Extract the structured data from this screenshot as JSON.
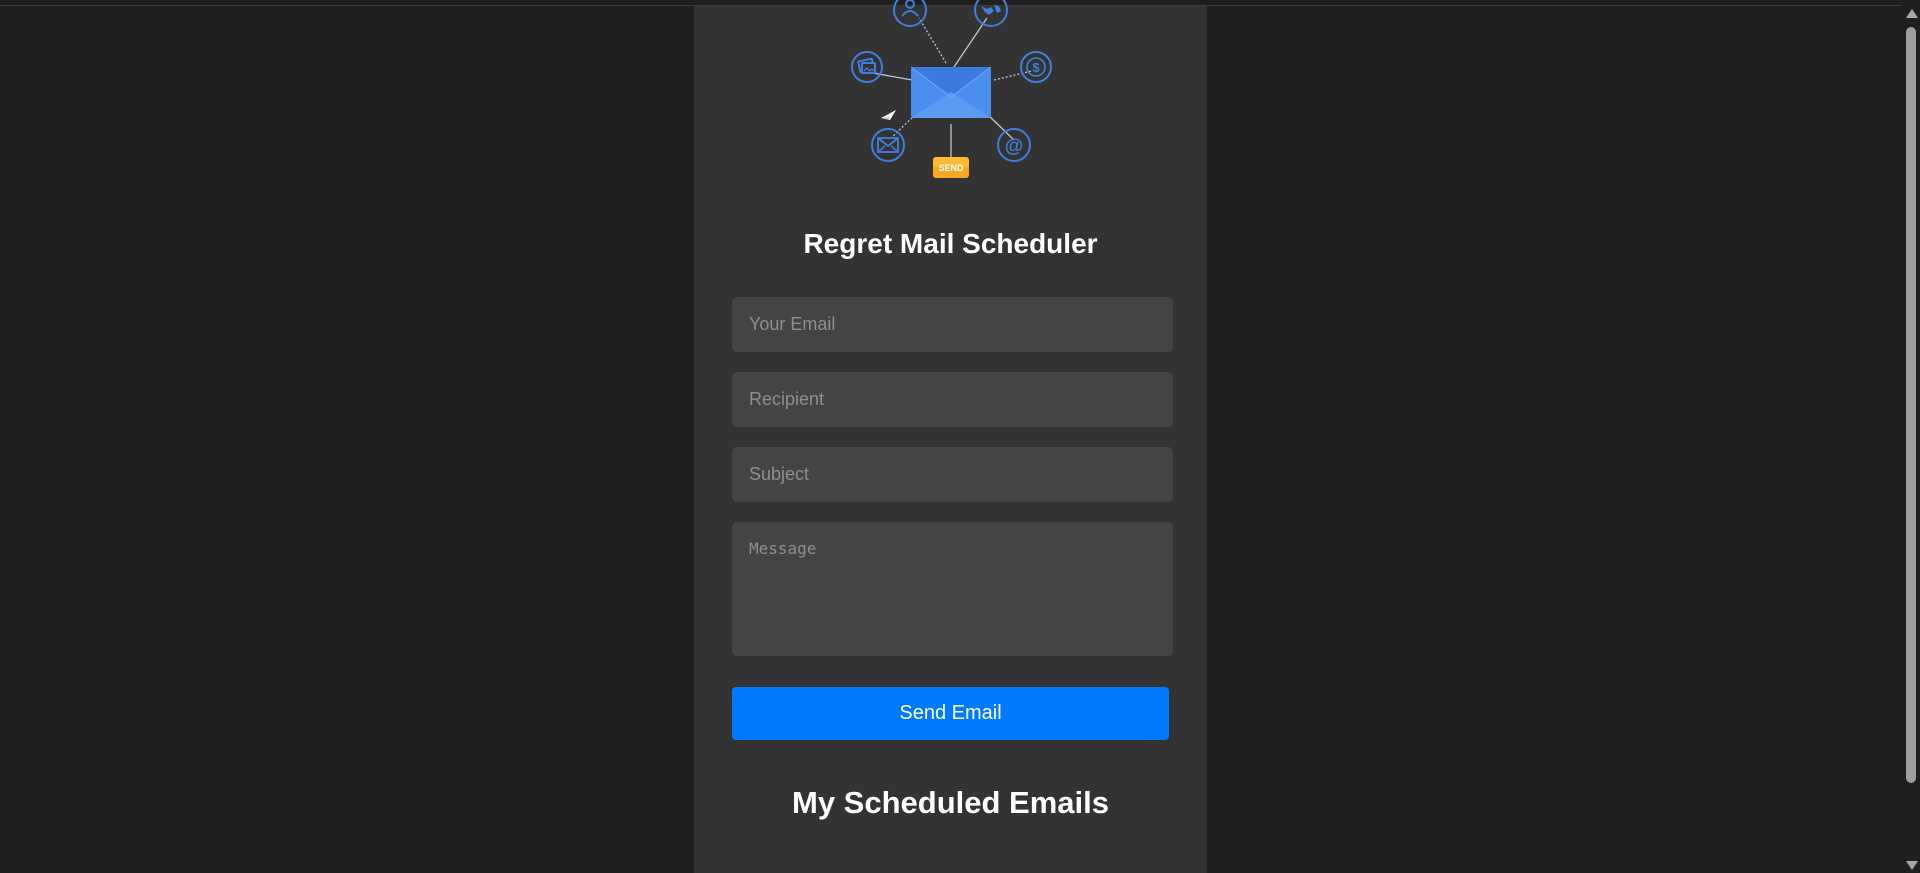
{
  "app": {
    "title": "Regret Mail Scheduler"
  },
  "hero": {
    "send_badge": "SEND",
    "at_symbol": "@",
    "dollar_symbol": "$"
  },
  "form": {
    "email_placeholder": "Your Email",
    "recipient_placeholder": "Recipient",
    "subject_placeholder": "Subject",
    "message_placeholder": "Message",
    "send_label": "Send Email"
  },
  "scheduled": {
    "heading": "My Scheduled Emails"
  },
  "colors": {
    "page_background": "#1f1f1f",
    "card_background": "#333333",
    "input_background": "#444444",
    "accent": "#007bff",
    "icon_blue": "#3f7fdc",
    "send_badge": "#f7a821"
  }
}
